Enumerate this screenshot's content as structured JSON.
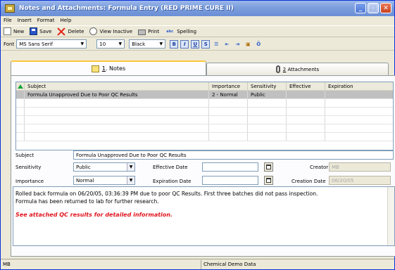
{
  "window": {
    "title": "Notes and Attachments:  Formula Entry  (RED PRIME CURE II)",
    "controls": [
      "minimize",
      "maximize",
      "close"
    ]
  },
  "menu": [
    "File",
    "Insert",
    "Format",
    "Help"
  ],
  "toolbar": {
    "new_label": "New",
    "save_label": "Save",
    "delete_label": "Delete",
    "view_inactive_label": "View Inactive",
    "print_label": "Print",
    "spelling_label": "Spelling"
  },
  "format_bar": {
    "font_label": "Font",
    "font_value": "MS Sans Serif",
    "size_value": "10",
    "color_value": "Black",
    "buttons": [
      "bold-icon",
      "italic-icon",
      "underline-icon",
      "strikethrough-icon",
      "bullets-icon",
      "align-left-icon",
      "align-right-icon",
      "insert-image-icon",
      "spell-icon"
    ]
  },
  "tabs": {
    "notes": {
      "number": "1",
      "label": "Notes",
      "icon": "notes-icon"
    },
    "attachments": {
      "number": "2",
      "label": "Attachments",
      "icon": "paperclip-icon"
    }
  },
  "grid": {
    "columns": [
      "Subject",
      "Importance",
      "Sensitivity",
      "Effective",
      "Expiration"
    ],
    "rows": [
      {
        "subject": "Formula Unapproved Due to Poor QC Results",
        "importance": "2 - Normal",
        "sensitivity": "Public",
        "effective": "",
        "expiration": ""
      }
    ]
  },
  "form": {
    "subject_label": "Subject",
    "subject_value": "Formula Unapproved Due to Poor QC Results",
    "sensitivity_label": "Sensitivity",
    "sensitivity_value": "Public",
    "importance_label": "Importance",
    "importance_value": "Normal",
    "effective_date_label": "Effective Date",
    "effective_date_value": "",
    "expiration_date_label": "Expiration Date",
    "expiration_date_value": "",
    "creator_label": "Creator",
    "creator_value": "MB",
    "creation_date_label": "Creation Date",
    "creation_date_value": "06/20/05"
  },
  "notes": {
    "line1": "Rolled back formula on 06/20/05, 03:36:39 PM  due to poor QC Results.  First three batches did not pass inspection.",
    "line2": "Formula has been returned to lab for further research.",
    "highlight": "See attached QC results for detailed information.",
    "highlight_color": "#e0171e"
  },
  "status_bar": {
    "user": "MB",
    "database": "Chemical Demo Data"
  }
}
